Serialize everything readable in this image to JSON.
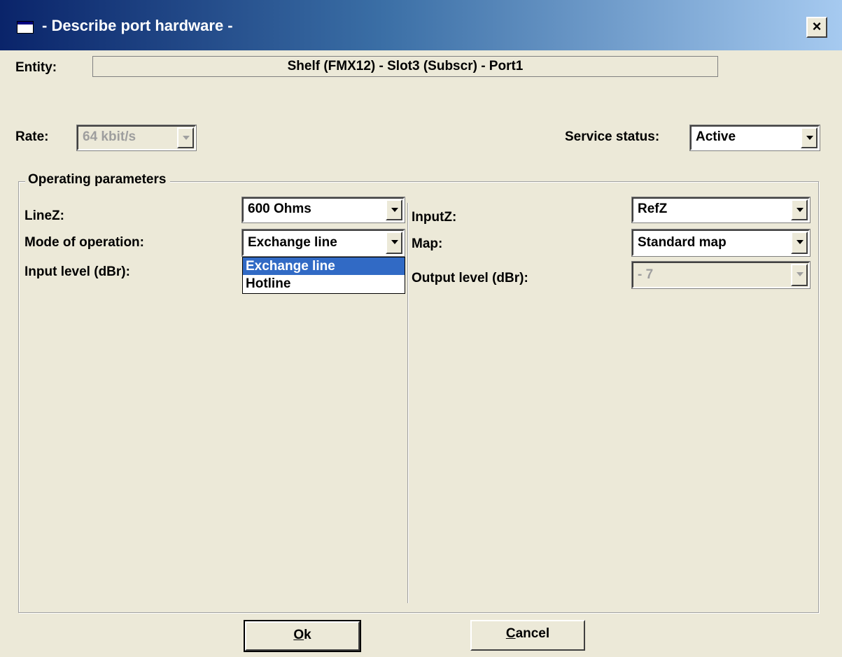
{
  "window": {
    "title": "- Describe port hardware -",
    "close_glyph": "×"
  },
  "entity": {
    "label": "Entity:",
    "value": "Shelf (FMX12) - Slot3 (Subscr) - Port1"
  },
  "rate": {
    "label": "Rate:",
    "value": "64 kbit/s"
  },
  "service_status": {
    "label": "Service status:",
    "value": "Active"
  },
  "operating_parameters": {
    "title": "Operating parameters",
    "linez": {
      "label": "LineZ:",
      "value": "600 Ohms"
    },
    "mode": {
      "label": "Mode of operation:",
      "value": "Exchange line"
    },
    "input_level": {
      "label": "Input level (dBr):"
    },
    "inputz": {
      "label": "InputZ:",
      "value": "RefZ"
    },
    "map": {
      "label": "Map:",
      "value": "Standard map"
    },
    "output_level": {
      "label": "Output level (dBr):",
      "value": "- 7"
    }
  },
  "mode_dropdown": {
    "options": [
      "Exchange line",
      "Hotline"
    ],
    "selected": "Exchange line"
  },
  "buttons": {
    "ok": {
      "mnemonic": "O",
      "rest": "k"
    },
    "cancel": {
      "mnemonic": "C",
      "rest": "ancel"
    }
  },
  "colors": {
    "title_gradient_start": "#0a246a",
    "title_gradient_end": "#a6caf0",
    "dialog_bg": "#ece9d8",
    "selection": "#316ac5"
  },
  "icons": {
    "window": "window-icon",
    "close": "close-icon",
    "dropdown": "chevron-down-icon"
  }
}
